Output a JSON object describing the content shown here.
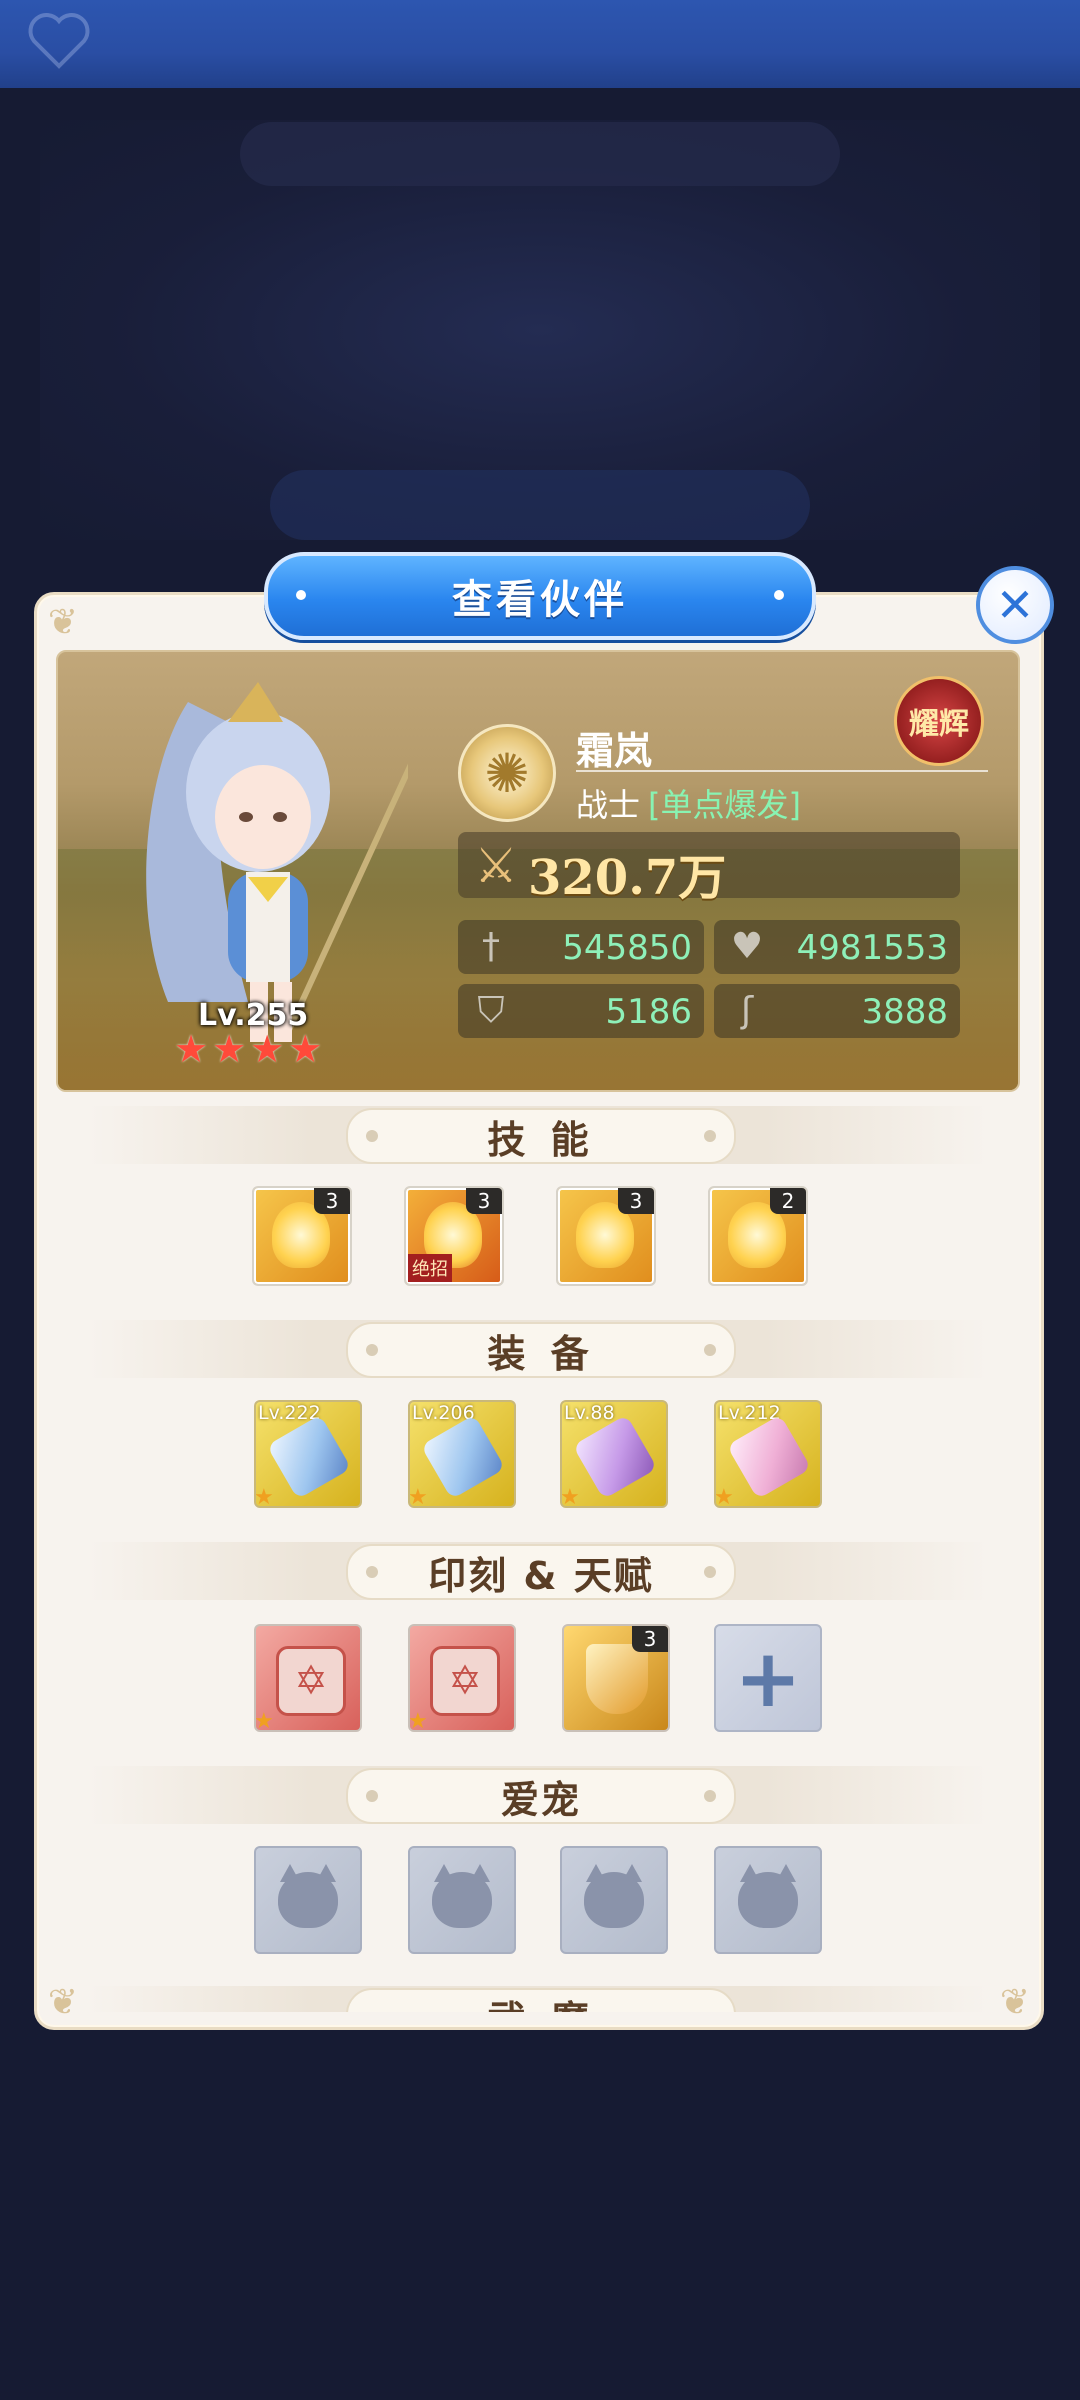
{
  "dialog": {
    "title": "查看伙伴",
    "close_icon": "close-icon"
  },
  "hero": {
    "name": "霜岚",
    "class": "战士",
    "class_tag": "[单点爆发]",
    "badge": "耀辉",
    "level": "Lv.255",
    "stars": 4,
    "power": "320.7万",
    "stats": [
      {
        "icon": "sword-icon",
        "value": "545850"
      },
      {
        "icon": "heart-icon",
        "value": "4981553"
      },
      {
        "icon": "shield-icon",
        "value": "5186"
      },
      {
        "icon": "boot-icon",
        "value": "3888"
      }
    ]
  },
  "sections": {
    "skills": "技  能",
    "equipment": "装  备",
    "runes": "印刻 & 天赋",
    "pets": "爱宠",
    "cut": "武 魔"
  },
  "skills": [
    {
      "count": "3"
    },
    {
      "count": "3",
      "tag": "绝招"
    },
    {
      "count": "3"
    },
    {
      "count": "2"
    }
  ],
  "equipment": [
    {
      "level": "Lv.222"
    },
    {
      "level": "Lv.206"
    },
    {
      "level": "Lv.88"
    },
    {
      "level": "Lv.212"
    }
  ],
  "talent_count": "3",
  "colors": {
    "accent_blue": "#2a86ef",
    "stat_green": "#8ef0b9",
    "power_gold": "#ffe6a6",
    "panel_bg": "#f7f3ee"
  }
}
